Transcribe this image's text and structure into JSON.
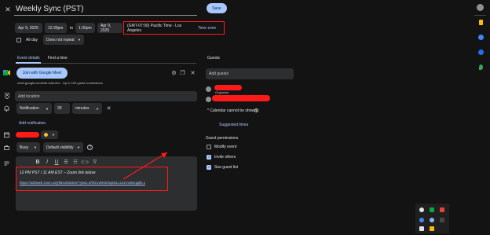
{
  "header": {
    "title": "Weekly Sync (PST)",
    "save_label": "Save",
    "close_icon": "close-icon"
  },
  "datetime": {
    "start_date": "Apr 9, 2025",
    "start_time": "12:30pm",
    "to_label": "to",
    "end_time": "1:30pm",
    "end_date": "Apr 9, 2025",
    "timezone": "(GMT-07:00) Pacific Time - Los Angeles",
    "timezone_label": "Time zone",
    "all_day_label": "All day",
    "repeat": "Does not repeat"
  },
  "tabs": {
    "event_details": "Event details",
    "find_time": "Find a time"
  },
  "meet": {
    "join_label": "Join with Google Meet",
    "info": "meet.google.com/ede-wltn-itnv · Up to 100 guest connections"
  },
  "location": {
    "placeholder": "Add location"
  },
  "notification": {
    "type": "Notification",
    "value": "30",
    "unit": "minutes",
    "add_label": "Add notification"
  },
  "status": {
    "busy": "Busy",
    "visibility": "Default visibility"
  },
  "description": {
    "line1": "12 PM PST / 11 AM EST – Zoom link below",
    "link": "https://us05web.zoom.us/j/88420384047?pwd=1RfGUvbK9zDqbOLLUzzXvb8Icpqlkt.1"
  },
  "guests": {
    "heading": "Guests",
    "add_placeholder": "Add guests",
    "organizer_label": "Organizer",
    "calendar_note": "* Calendar cannot be shown",
    "suggested_times": "Suggested times",
    "permissions_heading": "Guest permissions",
    "permissions": [
      {
        "label": "Modify event",
        "checked": false
      },
      {
        "label": "Invite others",
        "checked": true
      },
      {
        "label": "See guest list",
        "checked": true
      }
    ]
  },
  "colors": {
    "accent": "#a8c7fa",
    "redaction": "#ff1a1a",
    "event_color": "#f6bf26"
  }
}
